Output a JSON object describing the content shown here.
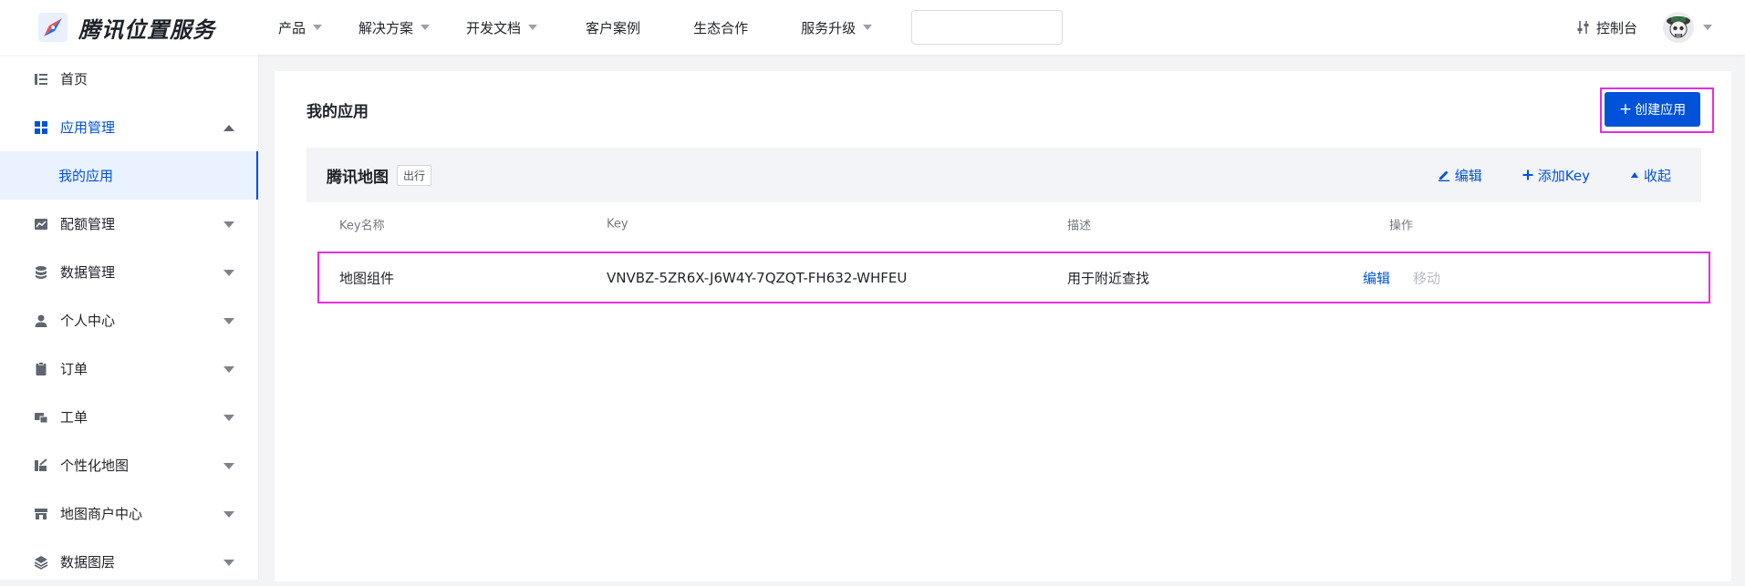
{
  "brand": {
    "name": "腾讯位置服务"
  },
  "nav": {
    "items": [
      {
        "label": "产品",
        "dropdown": true
      },
      {
        "label": "解决方案",
        "dropdown": true
      },
      {
        "label": "开发文档",
        "dropdown": true
      },
      {
        "label": "客户案例",
        "dropdown": false
      },
      {
        "label": "生态合作",
        "dropdown": false
      },
      {
        "label": "服务升级",
        "dropdown": true
      }
    ],
    "search_value": "",
    "console_label": "控制台"
  },
  "sidebar": {
    "items": [
      {
        "label": "首页",
        "icon": "list-icon"
      },
      {
        "label": "应用管理",
        "icon": "grid-icon",
        "expanded": true
      },
      {
        "label": "我的应用",
        "sub": true
      },
      {
        "label": "配额管理",
        "icon": "chart-icon"
      },
      {
        "label": "数据管理",
        "icon": "database-icon"
      },
      {
        "label": "个人中心",
        "icon": "user-icon"
      },
      {
        "label": "订单",
        "icon": "clipboard-icon"
      },
      {
        "label": "工单",
        "icon": "ticket-icon"
      },
      {
        "label": "个性化地图",
        "icon": "map-style-icon"
      },
      {
        "label": "地图商户中心",
        "icon": "store-icon"
      },
      {
        "label": "数据图层",
        "icon": "layers-icon"
      }
    ]
  },
  "main": {
    "title": "我的应用",
    "create_label": "创建应用",
    "app": {
      "name": "腾讯地图",
      "tag": "出行",
      "actions": {
        "edit": "编辑",
        "add_key": "添加Key",
        "collapse": "收起"
      }
    },
    "table": {
      "headers": [
        "Key名称",
        "Key",
        "描述",
        "操作"
      ],
      "rows": [
        {
          "name": "地图组件",
          "key": "VNVBZ-5ZR6X-J6W4Y-7QZQT-FH632-WHFEU",
          "desc": "用于附近查找",
          "edit": "编辑",
          "move": "移动"
        }
      ]
    }
  },
  "colors": {
    "accent": "#0052d9",
    "highlight": "#e52de0"
  }
}
